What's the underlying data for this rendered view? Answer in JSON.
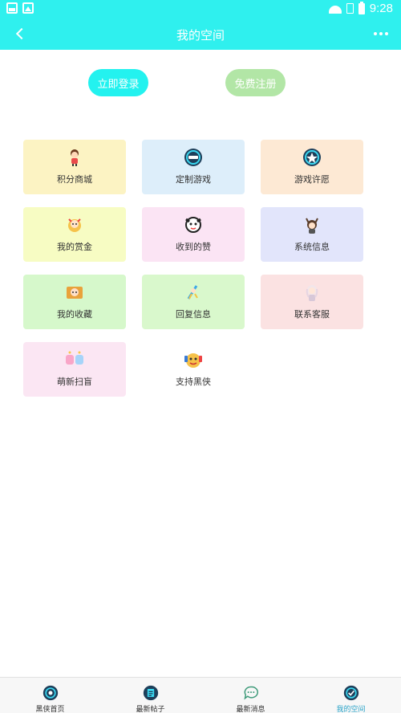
{
  "status_bar": {
    "time": "9:28"
  },
  "app_bar": {
    "title": "我的空间"
  },
  "auth": {
    "login_label": "立即登录",
    "register_label": "免费注册"
  },
  "menu": [
    {
      "label": "积分商城",
      "icon": "points-mall-icon",
      "bg": "#fcf3c3"
    },
    {
      "label": "定制游戏",
      "icon": "custom-game-icon",
      "bg": "#ddeefa"
    },
    {
      "label": "游戏许愿",
      "icon": "game-wish-icon",
      "bg": "#fde9d4"
    },
    {
      "label": "我的赏金",
      "icon": "bounty-icon",
      "bg": "#f7fcc3"
    },
    {
      "label": "收到的赞",
      "icon": "likes-icon",
      "bg": "#fbe4f4"
    },
    {
      "label": "系统信息",
      "icon": "system-info-icon",
      "bg": "#e2e5fb"
    },
    {
      "label": "我的收藏",
      "icon": "favorites-icon",
      "bg": "#d6f8cb"
    },
    {
      "label": "回复信息",
      "icon": "reply-info-icon",
      "bg": "#d9f8cc"
    },
    {
      "label": "联系客服",
      "icon": "customer-service-icon",
      "bg": "#fbe2e2"
    },
    {
      "label": "萌新扫盲",
      "icon": "newbie-guide-icon",
      "bg": "#fbe6f3"
    },
    {
      "label": "支持黑侠",
      "icon": "support-icon",
      "bg": "#ffffff"
    }
  ],
  "bottom_nav": [
    {
      "label": "黑侠首页",
      "icon": "home-icon",
      "active": false
    },
    {
      "label": "最新帖子",
      "icon": "posts-icon",
      "active": false
    },
    {
      "label": "最新消息",
      "icon": "messages-icon",
      "active": false
    },
    {
      "label": "我的空间",
      "icon": "my-space-icon",
      "active": true
    }
  ],
  "colors": {
    "accent": "#2ff0ee",
    "register": "#b2e6a6",
    "active_nav": "#2aa3c8"
  }
}
